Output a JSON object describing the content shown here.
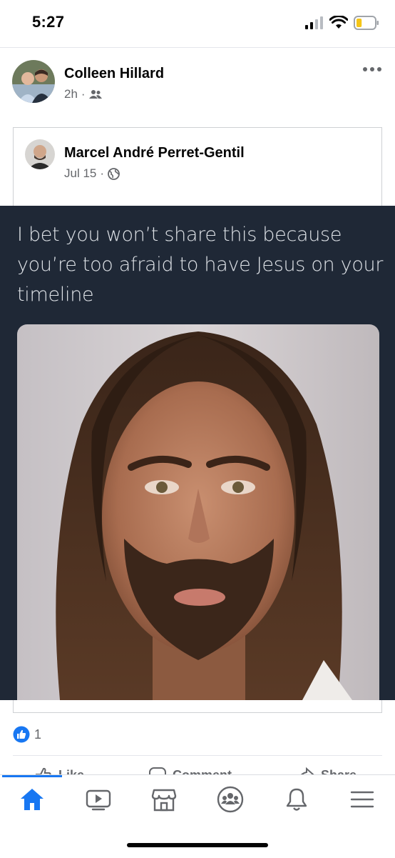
{
  "status_bar": {
    "time": "5:27",
    "battery_level": 0.3
  },
  "post": {
    "author": "Colleen Hillard",
    "time": "2h",
    "audience_icon": "friends-icon",
    "more_icon": "more-horizontal-icon"
  },
  "shared_post": {
    "author": "Marcel André Perret-Gentil",
    "date": "Jul 15",
    "audience_icon": "globe-icon",
    "meme_text": "I bet you won’t share this because you’re too afraid to have Jesus on your timeline"
  },
  "reactions": {
    "icon": "like-reaction-icon",
    "count": "1"
  },
  "actions": {
    "like": "Like",
    "comment": "Comment",
    "share": "Share"
  },
  "tabs": [
    {
      "name": "home",
      "active": true
    },
    {
      "name": "watch",
      "active": false
    },
    {
      "name": "marketplace",
      "active": false
    },
    {
      "name": "groups",
      "active": false
    },
    {
      "name": "notifications",
      "active": false
    },
    {
      "name": "menu",
      "active": false
    }
  ],
  "colors": {
    "accent": "#1877f2",
    "meta_text": "#65676b",
    "meme_background": "#1f2836",
    "battery": "#f5c518"
  }
}
